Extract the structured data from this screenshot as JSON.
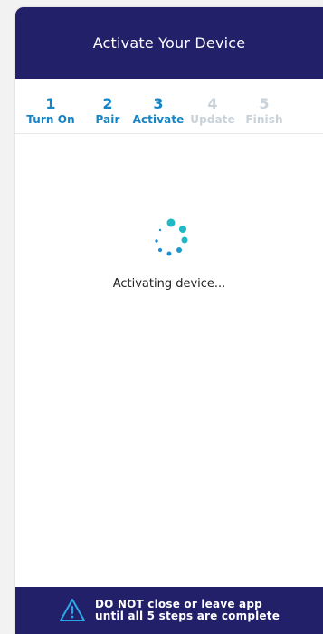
{
  "header": {
    "title": "Activate Your Device"
  },
  "steps": [
    {
      "number": "1",
      "label": "Turn On",
      "state": "active"
    },
    {
      "number": "2",
      "label": "Pair",
      "state": "active"
    },
    {
      "number": "3",
      "label": "Activate",
      "state": "active"
    },
    {
      "number": "4",
      "label": "Update",
      "state": "inactive"
    },
    {
      "number": "5",
      "label": "Finish",
      "state": "inactive"
    }
  ],
  "main": {
    "status_text": "Activating device...",
    "spinner_icon": "loading-spinner-icon"
  },
  "footer": {
    "warning_icon": "warning-triangle-icon",
    "warning_line1": "DO NOT close or leave app",
    "warning_line2": "until all 5 steps are complete"
  },
  "colors": {
    "header_bg": "#23206a",
    "active_step": "#1684c4",
    "inactive_step": "#c9d1d9",
    "spinner": "#1fb6c4"
  }
}
